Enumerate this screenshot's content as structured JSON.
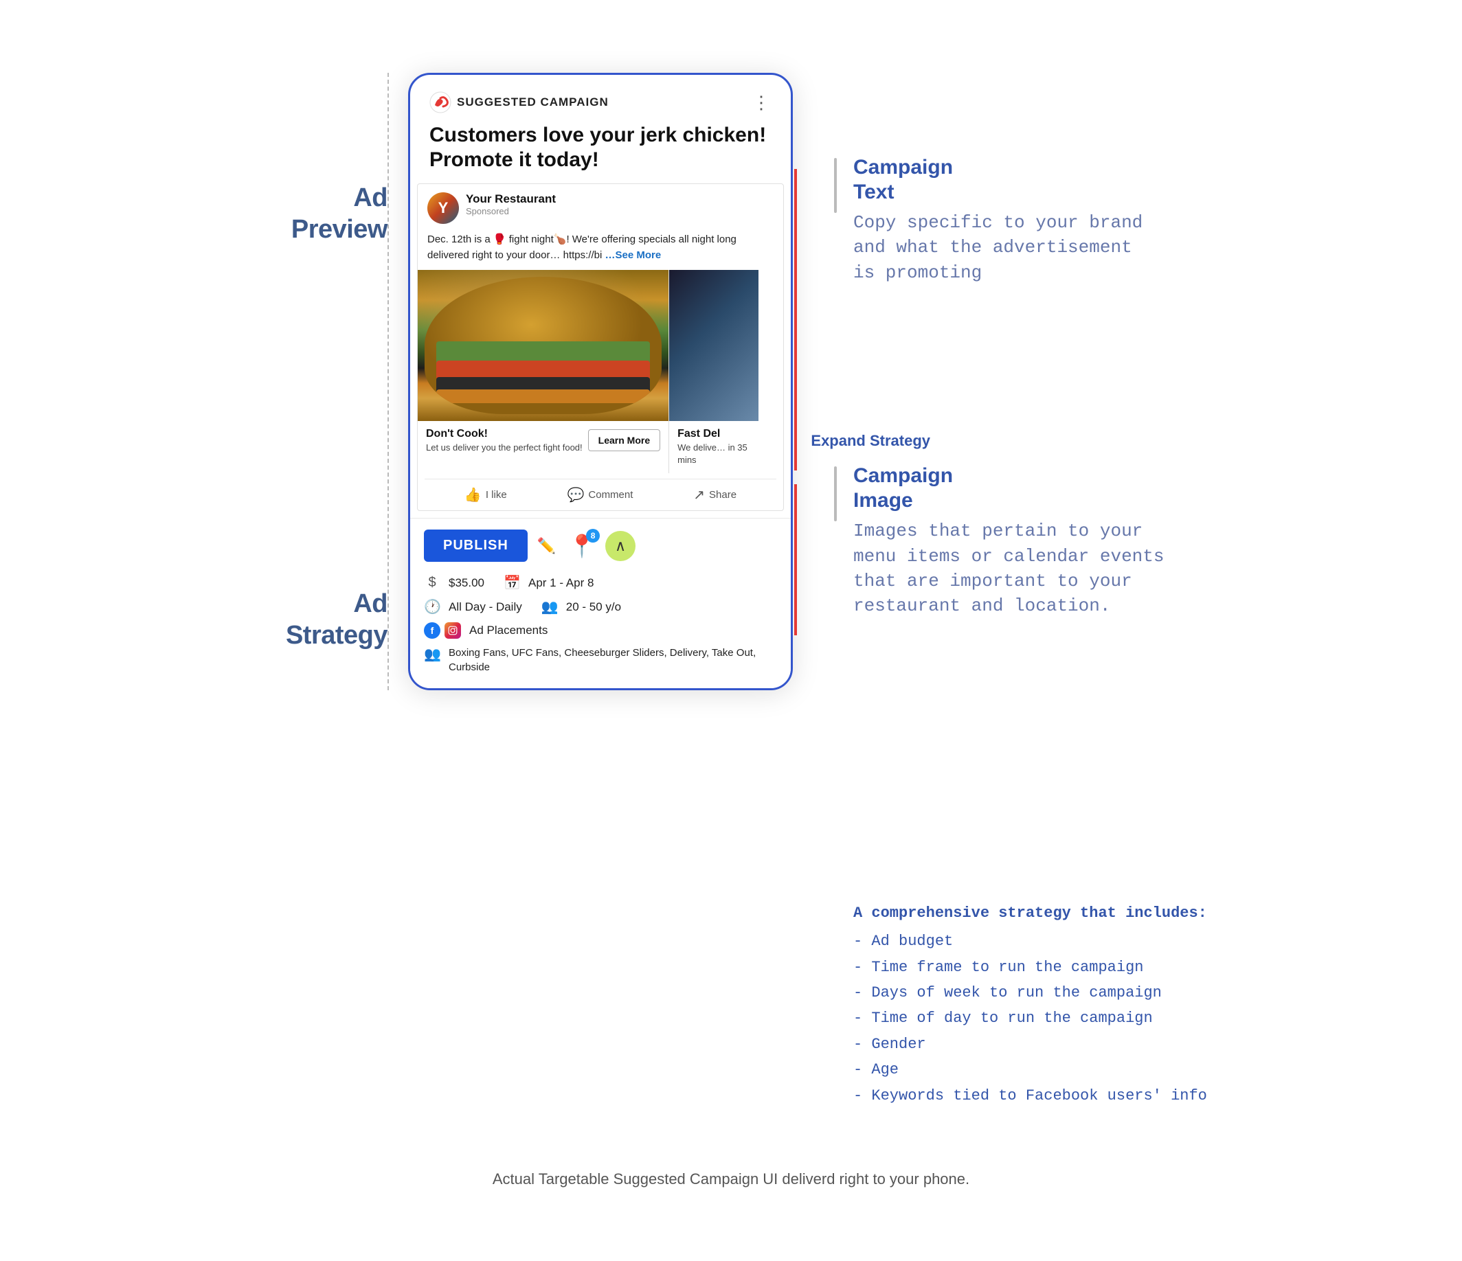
{
  "page": {
    "bottom_caption": "Actual Targetable Suggested Campaign UI deliverd right to your phone."
  },
  "left_labels": {
    "ad_preview": "Ad\nPreview",
    "ad_strategy": "Ad\nStrategy"
  },
  "phone": {
    "header": {
      "brand": "SUGGESTED CAMPAIGN",
      "headline": "Customers love your jerk chicken! Promote it today!"
    },
    "ad": {
      "restaurant_name": "Your Restaurant",
      "sponsored": "Sponsored",
      "text": "Dec. 12th is a 🥊 fight night🍗! We're offering specials all night long delivered right to your door… https://bi",
      "see_more": "…See More"
    },
    "carousel": [
      {
        "title": "Don't Cook!",
        "subtitle": "Let us deliver you the perfect fight food!",
        "learn_more": "Learn More"
      },
      {
        "title": "Fast Del",
        "subtitle": "We delive… in 35 mins"
      }
    ],
    "actions": {
      "like": "I like",
      "comment": "Comment",
      "share": "Share"
    },
    "bottom": {
      "publish": "PUBLISH",
      "badge_count": "8",
      "expand_strategy": "Expand Strategy",
      "budget": "$35.00",
      "date_range": "Apr 1 - Apr 8",
      "schedule": "All Day - Daily",
      "age_range": "20 - 50 y/o",
      "ad_placements": "Ad Placements",
      "interests": "Boxing Fans, UFC Fans, Cheeseburger Sliders, Delivery, Take Out, Curbside"
    }
  },
  "annotations": {
    "campaign_text": {
      "title": "Campaign\nText",
      "desc": "Copy specific to your brand\nand what the advertisement\nis promoting"
    },
    "campaign_image": {
      "title": "Campaign\nImage",
      "desc": "Images that pertain to your\nmenu items or calendar events\nthat are important to your\nrestaurant and location."
    },
    "strategy": {
      "title": "A comprehensive strategy that includes:",
      "items": [
        "- Ad budget",
        "- Time frame to run the campaign",
        "- Days of week to run the campaign",
        "- Time of day to run the campaign",
        "- Gender",
        "- Age",
        "- Keywords tied to Facebook users' info"
      ]
    }
  }
}
